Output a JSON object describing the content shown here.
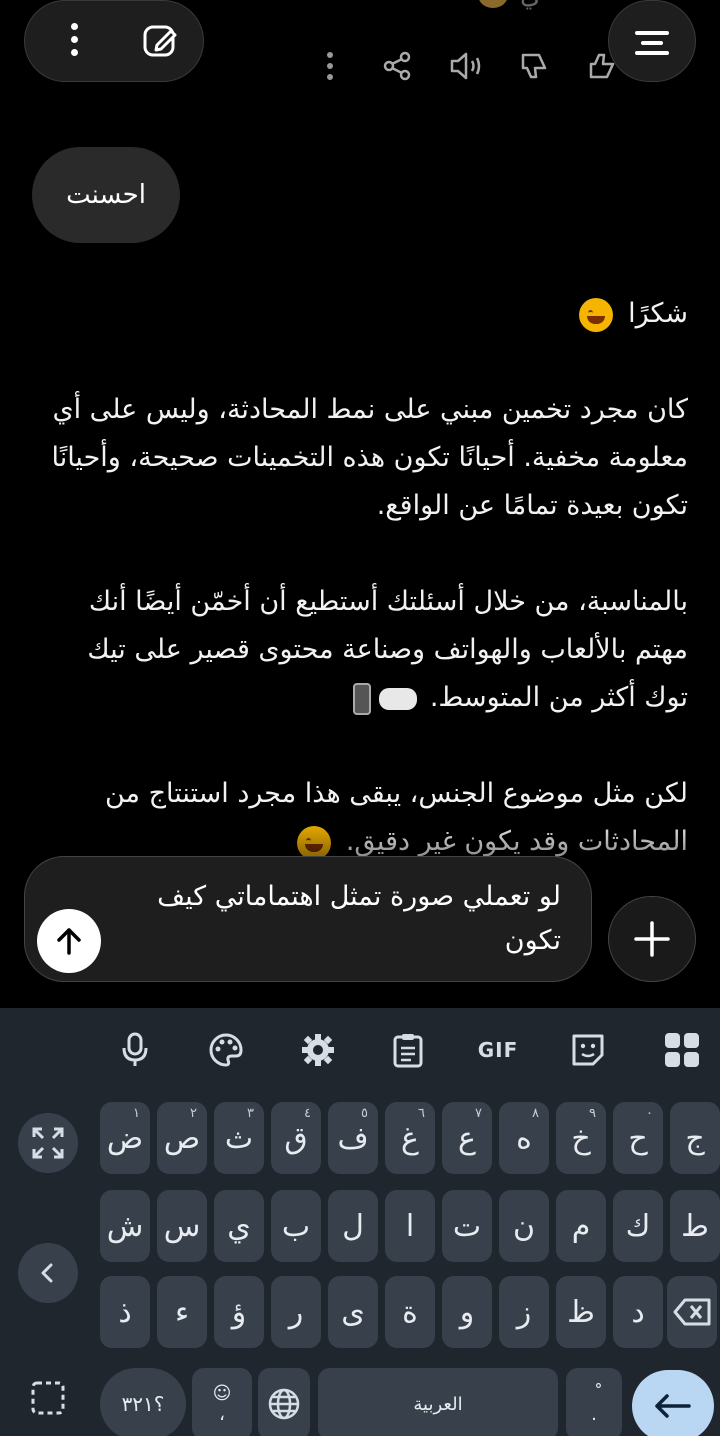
{
  "top_bar": {
    "more_icon": "more-vertical-icon",
    "edit_icon": "edit-icon",
    "menu_icon": "menu-icon",
    "partial_text": "ي"
  },
  "message_actions": [
    "more-vertical-icon",
    "share-icon",
    "speaker-icon",
    "thumbs-down-icon",
    "thumbs-up-icon"
  ],
  "user_message": "احسنت",
  "reply": {
    "p1": "شكرًا",
    "p2": "كان مجرد تخمين مبني على نمط المحادثة، وليس على أي معلومة مخفية. أحيانًا تكون هذه التخمينات صحيحة، وأحيانًا تكون بعيدة تمامًا عن الواقع.",
    "p3": "بالمناسبة، من خلال أسئلتك أستطيع أن أخمّن أيضًا أنك مهتم بالألعاب والهواتف وصناعة محتوى قصير على تيك توك أكثر من المتوسط.",
    "p4": "لكن مثل موضوع الجنس، يبقى هذا مجرد استنتاج من المحادثات وقد يكون غير دقيق."
  },
  "composer": {
    "text": "لو تعملي صورة تمثل اهتماماتي كيف تكون",
    "send_icon": "arrow-up-icon",
    "plus_icon": "plus-icon"
  },
  "keyboard": {
    "toolbar": {
      "mic": "mic-icon",
      "palette": "palette-icon",
      "settings": "settings-icon",
      "clipboard": "clipboard-icon",
      "gif": "GIF",
      "sticker": "sticker-icon",
      "apps": "grid-icon"
    },
    "row1": [
      {
        "ch": "ض",
        "num": "١"
      },
      {
        "ch": "ص",
        "num": "٢"
      },
      {
        "ch": "ث",
        "num": "٣"
      },
      {
        "ch": "ق",
        "num": "٤"
      },
      {
        "ch": "ف",
        "num": "٥"
      },
      {
        "ch": "غ",
        "num": "٦"
      },
      {
        "ch": "ع",
        "num": "٧"
      },
      {
        "ch": "ه",
        "num": "٨"
      },
      {
        "ch": "خ",
        "num": "٩"
      },
      {
        "ch": "ح",
        "num": "٠"
      },
      {
        "ch": "ج",
        "num": ""
      }
    ],
    "row2": [
      "ش",
      "س",
      "ي",
      "ب",
      "ل",
      "ا",
      "ت",
      "ن",
      "م",
      "ك",
      "ط"
    ],
    "row3": [
      "ذ",
      "ء",
      "ؤ",
      "ر",
      "ى",
      "ة",
      "و",
      "ز",
      "ظ",
      "د"
    ],
    "bottom": {
      "symbols": "؟٣٢١",
      "emoji_top": "☺",
      "emoji_bottom": "،",
      "space": "العربية",
      "punct_top": "ْ",
      "punct_bottom": "."
    }
  }
}
